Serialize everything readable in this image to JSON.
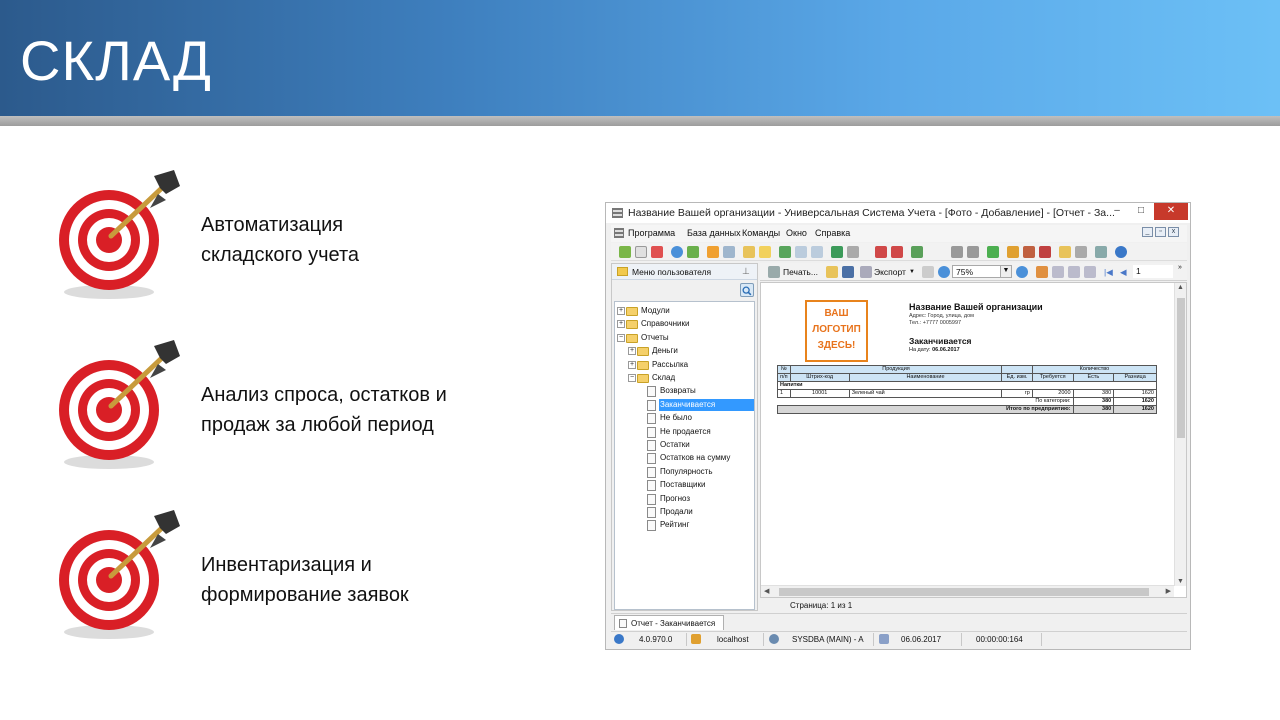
{
  "slide": {
    "title": "СКЛАД",
    "bullets": [
      {
        "line1": "Автоматизация",
        "line2": "складского учета",
        "icon": "target-dart-icon"
      },
      {
        "line1": "Анализ спроса, остатков и",
        "line2": "продаж за любой период",
        "icon": "target-dart-icon"
      },
      {
        "line1": "Инвентаризация и",
        "line2": "формирование заявок",
        "icon": "target-dart-icon"
      }
    ]
  },
  "app": {
    "window_title": "Название Вашей организации - Универсальная Система Учета - [Фото - Добавление] - [Отчет - За...",
    "window_controls": {
      "minimize": "–",
      "maximize": "□",
      "close": "✕"
    },
    "menu": [
      "Программа",
      "База данных",
      "Команды",
      "Окно",
      "Справка"
    ],
    "left_panel": {
      "title": "Меню пользователя",
      "tree": [
        {
          "label": "Модули",
          "kind": "folder",
          "expander": "+",
          "level": 0
        },
        {
          "label": "Справочники",
          "kind": "folder",
          "expander": "+",
          "level": 0
        },
        {
          "label": "Отчеты",
          "kind": "folder",
          "expander": "−",
          "level": 0
        },
        {
          "label": "Деньги",
          "kind": "folder",
          "expander": "+",
          "level": 1
        },
        {
          "label": "Рассылка",
          "kind": "folder",
          "expander": "+",
          "level": 1
        },
        {
          "label": "Склад",
          "kind": "folder",
          "expander": "−",
          "level": 1
        },
        {
          "label": "Возвраты",
          "kind": "doc",
          "level": 2
        },
        {
          "label": "Заканчивается",
          "kind": "doc",
          "level": 2,
          "selected": true
        },
        {
          "label": "Не было",
          "kind": "doc",
          "level": 2
        },
        {
          "label": "Не продается",
          "kind": "doc",
          "level": 2
        },
        {
          "label": "Остатки",
          "kind": "doc",
          "level": 2
        },
        {
          "label": "Остатков на сумму",
          "kind": "doc",
          "level": 2
        },
        {
          "label": "Популярность",
          "kind": "doc",
          "level": 2
        },
        {
          "label": "Поставщики",
          "kind": "doc",
          "level": 2
        },
        {
          "label": "Прогноз",
          "kind": "doc",
          "level": 2
        },
        {
          "label": "Продали",
          "kind": "doc",
          "level": 2
        },
        {
          "label": "Рейтинг",
          "kind": "doc",
          "level": 2
        }
      ]
    },
    "report_toolbar": {
      "print": "Печать...",
      "export": "Экспорт",
      "zoom": "75%",
      "page": "1"
    },
    "report": {
      "logo_lines": [
        "ВАШ",
        "ЛОГОТИП",
        "ЗДЕСЬ!"
      ],
      "org_name": "Название Вашей организации",
      "address": "Адрес: Город, улица, дом",
      "phone": "Тел.: +7777 0005997",
      "title": "Заканчивается",
      "date_label": "На дату:",
      "date_value": "06.06.2017",
      "table": {
        "group_headers": {
          "no": "№",
          "product": "Продукция",
          "quantity": "Количество"
        },
        "sub_headers": {
          "no": "п/п",
          "barcode": "Штрих-код",
          "name": "Наименование",
          "unit": "Ед. изм.",
          "required": "Требуется",
          "available": "Есть",
          "diff": "Разница"
        },
        "category": "Напитки",
        "rows": [
          {
            "no": "1",
            "barcode": "10001",
            "name": "Зеленый чай",
            "unit": "гр",
            "required": "2000",
            "available": "380",
            "diff": "1620"
          }
        ],
        "category_total": {
          "label": "По категории:",
          "available": "380",
          "diff": "1620"
        },
        "grand_total": {
          "label": "Итого по предприятию:",
          "available": "380",
          "diff": "1620"
        }
      }
    },
    "page_status": "Страница: 1 из 1",
    "tab_label": "Отчет - Заканчивается",
    "status": {
      "version": "4.0.970.0",
      "host": "localhost",
      "user": "SYSDBA (MAIN) - A",
      "date": "06.06.2017",
      "time": "00:00:00:164"
    }
  },
  "colors": {
    "header_gradient_start": "#2c5a8c",
    "header_gradient_end": "#6cc0f6",
    "selection": "#3399ff",
    "logo_orange": "#e8731c",
    "table_header": "#cde4f5",
    "close_button": "#c7392b"
  }
}
